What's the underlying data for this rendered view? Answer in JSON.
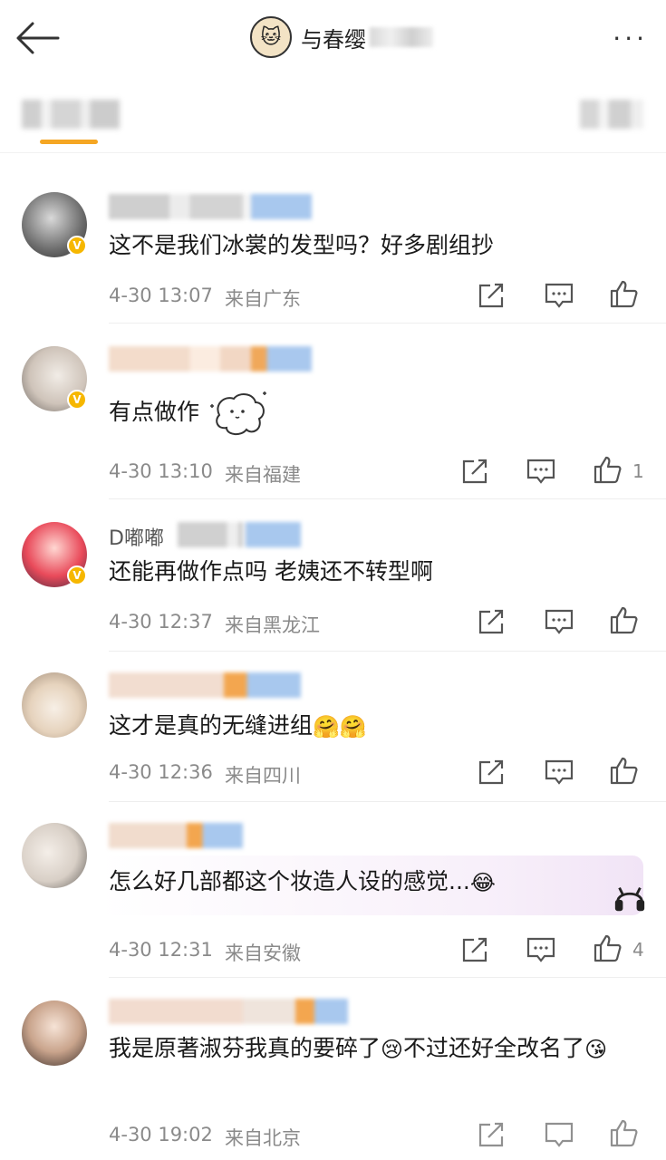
{
  "header": {
    "title": "与春缨",
    "more": "···"
  },
  "comments": [
    {
      "text": "这不是我们冰裳的发型吗？好多剧组抄",
      "time": "4-30 13:07",
      "location": "来自广东",
      "likes": ""
    },
    {
      "text": "有点做作",
      "time": "4-30 13:10",
      "location": "来自福建",
      "likes": "1"
    },
    {
      "name": "D嘟嘟",
      "text": "还能再做作点吗 老姨还不转型啊",
      "time": "4-30 12:37",
      "location": "来自黑龙江",
      "likes": ""
    },
    {
      "text": "这才是真的无缝进组",
      "emoji": "🤗🤗",
      "time": "4-30 12:36",
      "location": "来自四川",
      "likes": ""
    },
    {
      "text": "怎么好几部都这个妆造人设的感觉...",
      "emoji": "😂",
      "time": "4-30 12:31",
      "location": "来自安徽",
      "likes": "4"
    },
    {
      "text": "我是原著淑芬我真的要碎了",
      "emoji": "😢",
      "text2": "不过还好全改名了",
      "emoji2": "😘",
      "time": "4-30 19:02",
      "location": "来自北京",
      "likes": ""
    }
  ],
  "colors": {
    "accent": "#f5a623",
    "verified": "#f6b700",
    "meta": "#8a8a8a"
  }
}
